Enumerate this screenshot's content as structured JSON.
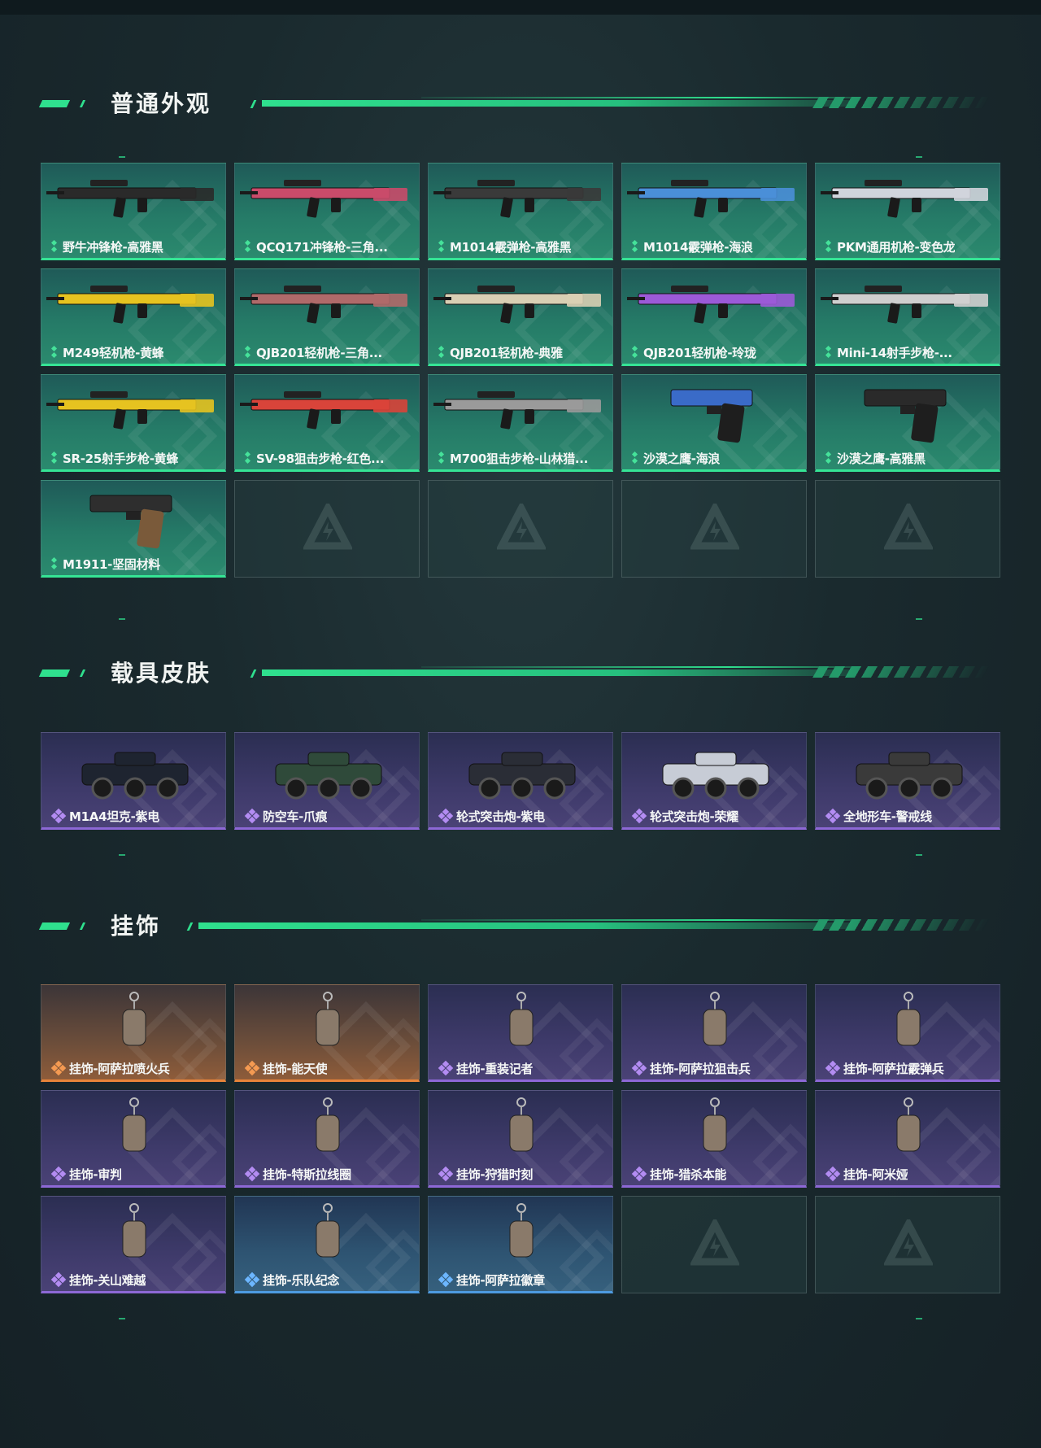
{
  "sections": {
    "weapons": {
      "title": "普通外观",
      "items": [
        {
          "label": "野牛冲锋枪-高雅黑",
          "icon": "smg-icon"
        },
        {
          "label": "QCQ171冲锋枪-三角...",
          "icon": "smg-icon"
        },
        {
          "label": "M1014霰弹枪-高雅黑",
          "icon": "shotgun-icon"
        },
        {
          "label": "M1014霰弹枪-海浪",
          "icon": "shotgun-icon"
        },
        {
          "label": "PKM通用机枪-变色龙",
          "icon": "machine-gun-icon"
        },
        {
          "label": "M249轻机枪-黄蜂",
          "icon": "light-machine-gun-icon"
        },
        {
          "label": "QJB201轻机枪-三角...",
          "icon": "light-machine-gun-icon"
        },
        {
          "label": "QJB201轻机枪-典雅",
          "icon": "light-machine-gun-icon"
        },
        {
          "label": "QJB201轻机枪-玲珑",
          "icon": "light-machine-gun-icon"
        },
        {
          "label": "Mini-14射手步枪-...",
          "icon": "rifle-icon"
        },
        {
          "label": "SR-25射手步枪-黄蜂",
          "icon": "rifle-icon"
        },
        {
          "label": "SV-98狙击步枪-红色...",
          "icon": "sniper-rifle-icon"
        },
        {
          "label": "M700狙击步枪-山林猎...",
          "icon": "sniper-rifle-icon"
        },
        {
          "label": "沙漠之鹰-海浪",
          "icon": "pistol-icon"
        },
        {
          "label": "沙漠之鹰-高雅黑",
          "icon": "pistol-icon"
        },
        {
          "label": "M1911-坚固材料",
          "icon": "pistol-icon"
        }
      ],
      "empty_slots": 4
    },
    "vehicles": {
      "title": "载具皮肤",
      "items": [
        {
          "label": "M1A4坦克-紫电",
          "icon": "tank-icon"
        },
        {
          "label": "防空车-爪痕",
          "icon": "armored-vehicle-icon"
        },
        {
          "label": "轮式突击炮-紫电",
          "icon": "assault-vehicle-icon"
        },
        {
          "label": "轮式突击炮-荣耀",
          "icon": "assault-vehicle-icon"
        },
        {
          "label": "全地形车-警戒线",
          "icon": "atv-icon"
        }
      ]
    },
    "charms": {
      "title": "挂饰",
      "items": [
        {
          "label": "挂饰-阿萨拉喷火兵",
          "rarity": "orange",
          "icon": "figure-charm-icon"
        },
        {
          "label": "挂饰-能天使",
          "rarity": "orange",
          "icon": "tag-charm-icon"
        },
        {
          "label": "挂饰-重装记者",
          "rarity": "purple",
          "icon": "figure-charm-icon"
        },
        {
          "label": "挂饰-阿萨拉狙击兵",
          "rarity": "purple",
          "icon": "figure-charm-icon"
        },
        {
          "label": "挂饰-阿萨拉霰弹兵",
          "rarity": "purple",
          "icon": "figure-charm-icon"
        },
        {
          "label": "挂饰-审判",
          "rarity": "purple",
          "icon": "card-charm-icon"
        },
        {
          "label": "挂饰-特斯拉线圈",
          "rarity": "purple",
          "icon": "coil-charm-icon"
        },
        {
          "label": "挂饰-狩猎时刻",
          "rarity": "purple",
          "icon": "antler-charm-icon"
        },
        {
          "label": "挂饰-猎杀本能",
          "rarity": "purple",
          "icon": "antler-charm-icon"
        },
        {
          "label": "挂饰-阿米娅",
          "rarity": "purple",
          "icon": "bunny-charm-icon"
        },
        {
          "label": "挂饰-关山难越",
          "rarity": "purple",
          "icon": "capsule-charm-icon"
        },
        {
          "label": "挂饰-乐队纪念",
          "rarity": "blue",
          "icon": "badge-charm-icon"
        },
        {
          "label": "挂饰-阿萨拉徽章",
          "rarity": "blue",
          "icon": "medal-charm-icon"
        }
      ],
      "empty_slots": 2
    }
  },
  "colors": {
    "accent_green": "#2fe08e",
    "rarity_green": "#35e495",
    "rarity_purple": "#8d68d6",
    "rarity_orange": "#e8843a",
    "rarity_blue": "#4d9ae0"
  }
}
